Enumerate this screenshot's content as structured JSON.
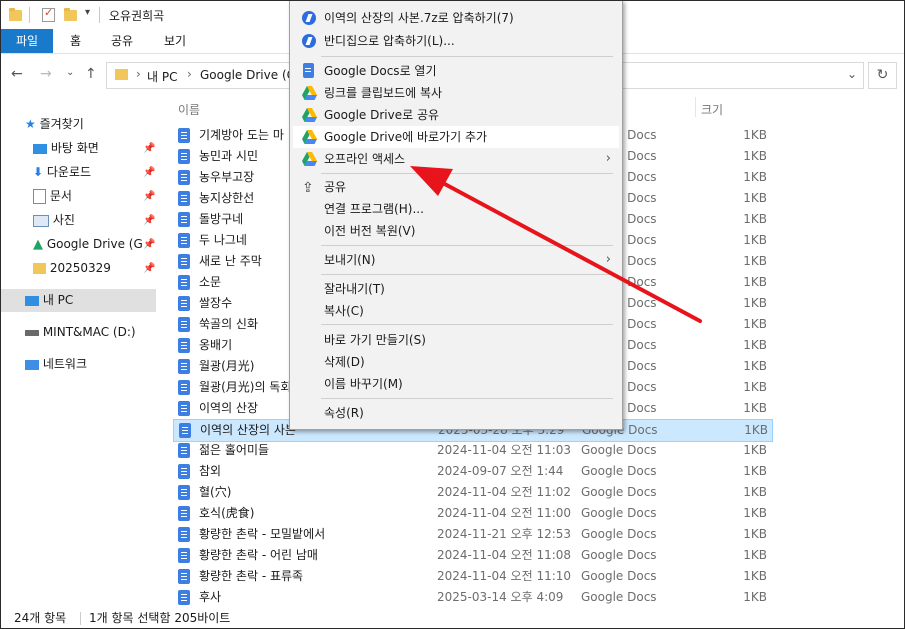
{
  "window": {
    "title": "오유권희곡"
  },
  "ribbon": {
    "tabs": [
      "파일",
      "홈",
      "공유",
      "보기"
    ]
  },
  "address": {
    "crumbs": [
      "내 PC",
      "Google Drive (G:"
    ]
  },
  "sidebar": {
    "quick_access": "즐겨찾기",
    "items": [
      "바탕 화면",
      "다운로드",
      "문서",
      "사진",
      "Google Drive (G",
      "20250329"
    ],
    "this_pc": "내 PC",
    "drive": "MINT&MAC (D:)",
    "network": "네트워크"
  },
  "columns": {
    "name": "이름",
    "size": "크기"
  },
  "files": [
    {
      "name": "기계방아 도는 마",
      "date": "",
      "type": "Google Docs",
      "size": "1KB"
    },
    {
      "name": "농민과 시민",
      "date": "",
      "type": "Google Docs",
      "size": "1KB"
    },
    {
      "name": "농우부고장",
      "date": "",
      "type": "Google Docs",
      "size": "1KB"
    },
    {
      "name": "농지상한선",
      "date": "",
      "type": "Google Docs",
      "size": "1KB"
    },
    {
      "name": "돌방구네",
      "date": "",
      "type": "Google Docs",
      "size": "1KB"
    },
    {
      "name": "두 나그네",
      "date": "",
      "type": "Google Docs",
      "size": "1KB"
    },
    {
      "name": "새로 난 주막",
      "date": "",
      "type": "Google Docs",
      "size": "1KB"
    },
    {
      "name": "소문",
      "date": "",
      "type": "Google Docs",
      "size": "1KB"
    },
    {
      "name": "쌀장수",
      "date": "",
      "type": "Google Docs",
      "size": "1KB"
    },
    {
      "name": "쑥골의 신화",
      "date": "",
      "type": "Google Docs",
      "size": "1KB"
    },
    {
      "name": "옹배기",
      "date": "",
      "type": "Google Docs",
      "size": "1KB"
    },
    {
      "name": "월광(月光)",
      "date": "",
      "type": "Google Docs",
      "size": "1KB"
    },
    {
      "name": "월광(月光)의 독회",
      "date": "",
      "type": "Google Docs",
      "size": "1KB"
    },
    {
      "name": "이역의 산장",
      "date": "",
      "type": "Google Docs",
      "size": "1KB"
    },
    {
      "name": "이역의 산장의 사본",
      "date": "2025-03-28 오후 3:29",
      "type": "Google Docs",
      "size": "1KB"
    },
    {
      "name": "젊은 홀어미들",
      "date": "2024-11-04 오전 11:03",
      "type": "Google Docs",
      "size": "1KB"
    },
    {
      "name": "참외",
      "date": "2024-09-07 오전 1:44",
      "type": "Google Docs",
      "size": "1KB"
    },
    {
      "name": "혈(穴)",
      "date": "2024-11-04 오전 11:02",
      "type": "Google Docs",
      "size": "1KB"
    },
    {
      "name": "호식(虎食)",
      "date": "2024-11-04 오전 11:00",
      "type": "Google Docs",
      "size": "1KB"
    },
    {
      "name": "황량한 촌락 - 모밀밭에서",
      "date": "2024-11-21 오후 12:53",
      "type": "Google Docs",
      "size": "1KB"
    },
    {
      "name": "황량한 촌락 - 어린 남매",
      "date": "2024-11-04 오전 11:08",
      "type": "Google Docs",
      "size": "1KB"
    },
    {
      "name": "황량한 촌락 - 표류족",
      "date": "2024-11-04 오전 11:10",
      "type": "Google Docs",
      "size": "1KB"
    },
    {
      "name": "후사",
      "date": "2025-03-14 오후 4:09",
      "type": "Google Docs",
      "size": "1KB"
    }
  ],
  "status": {
    "count": "24개 항목",
    "selection": "1개 항목 선택함 205바이트"
  },
  "menu": {
    "compress_7z": "이역의 산장의 사본.7z로 압축하기(7)",
    "compress_bandizip": "반디집으로 압축하기(L)...",
    "open_docs": "Google Docs로 열기",
    "copy_link": "링크를 클립보드에 복사",
    "share_drive": "Google Drive로 공유",
    "add_shortcut": "Google Drive에 바로가기 추가",
    "offline": "오프라인 액세스",
    "share": "공유",
    "open_with": "연결 프로그램(H)...",
    "restore": "이전 버전 복원(V)",
    "send_to": "보내기(N)",
    "cut": "잘라내기(T)",
    "copy": "복사(C)",
    "shortcut": "바로 가기 만들기(S)",
    "delete": "삭제(D)",
    "rename": "이름 바꾸기(M)",
    "properties": "속성(R)"
  },
  "colors": {
    "accent": "#1979ca",
    "selection": "#cce8ff",
    "arrow": "#e8141b"
  }
}
